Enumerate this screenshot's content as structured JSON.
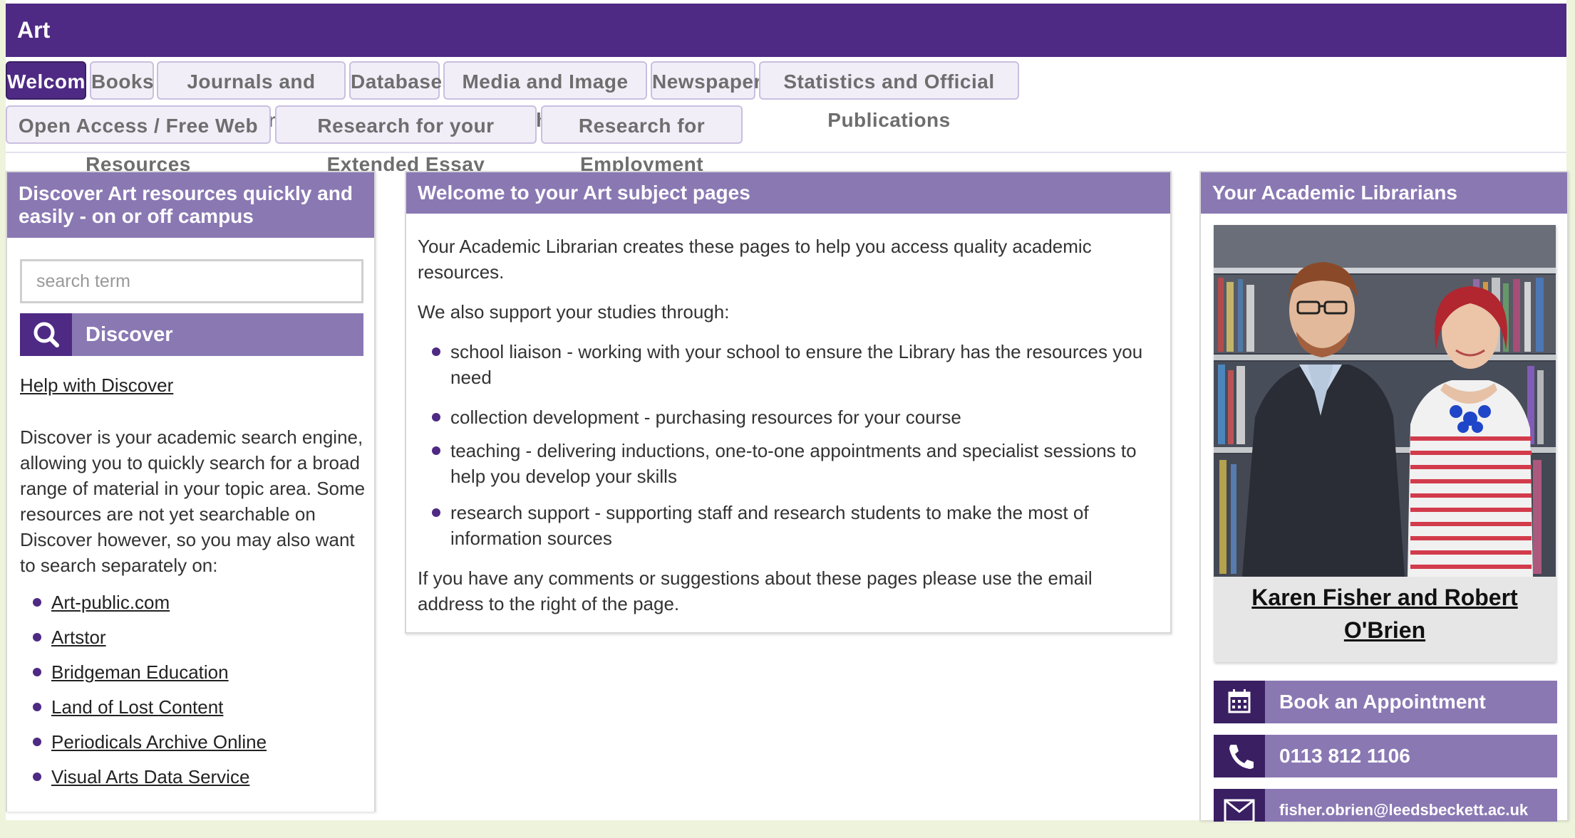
{
  "app": {
    "title": "Art"
  },
  "tabs": [
    {
      "label": "Welcome",
      "active": true
    },
    {
      "label": "Books"
    },
    {
      "label": "Journals and Magazines"
    },
    {
      "label": "Databases"
    },
    {
      "label": "Media and Image Archives"
    },
    {
      "label": "Newspapers"
    },
    {
      "label": "Statistics and Official Publications"
    },
    {
      "label": "Open Access / Free Web Resources"
    },
    {
      "label": "Research for your Extended Essay"
    },
    {
      "label": "Research for Employment"
    }
  ],
  "discover": {
    "heading": "Discover Art resources quickly and easily - on or off campus",
    "search_placeholder": "search term",
    "button_label": "Discover",
    "button_icon": "search-icon",
    "help_link": "Help with Discover",
    "description": "Discover is your academic search engine, allowing you to quickly search for a broad range of material in your topic area. Some resources are not yet searchable on Discover however, so you may also want to search separately on:",
    "links": [
      "Art-public.com",
      "Artstor",
      "Bridgeman Education",
      "Land of Lost Content",
      "Periodicals Archive Online",
      "Visual Arts Data Service"
    ]
  },
  "welcome": {
    "heading": "Welcome to your Art subject pages",
    "intro": "Your Academic Librarian creates these pages to help you access quality academic resources.",
    "support_lead": "We also support your studies through:",
    "items": [
      "school liaison - working with your school to ensure the Library has the resources you need",
      "collection development - purchasing resources for your course",
      "teaching - delivering inductions, one-to-one appointments and specialist sessions to help you develop your skills",
      "research support - supporting staff and research students to make the most of information sources"
    ],
    "closing": "If you have any comments or suggestions about these pages please use the email address to the right of the page."
  },
  "librarians": {
    "heading": "Your Academic Librarians",
    "names": "Karen Fisher and Robert O'Brien",
    "book_label": "Book an Appointment",
    "book_icon": "calendar-icon",
    "phone": "0113 812 1106",
    "phone_icon": "phone-icon",
    "email": "fisher.obrien@leedsbeckett.ac.uk",
    "email_icon": "envelope-icon"
  },
  "colors": {
    "brand_dark": "#4e2a84",
    "brand_mid": "#8a78b3",
    "tab_bg": "#f2eef8"
  }
}
